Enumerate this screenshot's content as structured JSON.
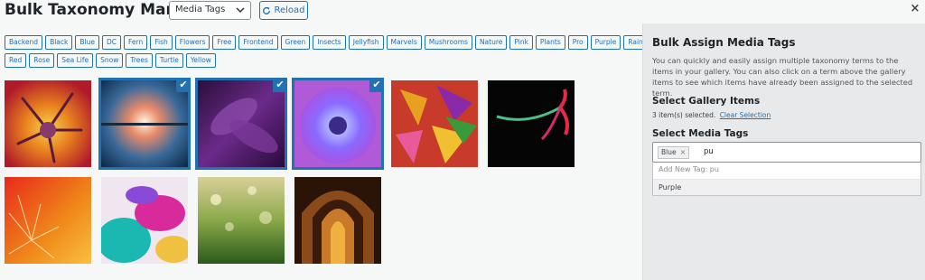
{
  "app": {
    "title": "Bulk Taxonomy Manager",
    "taxonomy_select": "Media Tags",
    "reload_label": "Reload",
    "close_label": "×"
  },
  "terms_row1": [
    "Backend",
    "Black",
    "Blue",
    "DC",
    "Fern",
    "Fish",
    "Flowers",
    "Free",
    "Frontend",
    "Green",
    "Insects",
    "Jellyfish",
    "Marvels",
    "Mushrooms",
    "Nature",
    "Pink",
    "Plants",
    "Pro",
    "Purple",
    "Rainbow"
  ],
  "terms_row2": [
    "Red",
    "Rose",
    "Sea Life",
    "Snow",
    "Trees",
    "Turtle",
    "Yellow"
  ],
  "gallery": {
    "items": [
      {
        "name": "flower-macro",
        "selected": false
      },
      {
        "name": "sunset-reflection",
        "selected": true
      },
      {
        "name": "purple-leaves",
        "selected": true
      },
      {
        "name": "chrysanthemum",
        "selected": true
      },
      {
        "name": "autumn-leaves",
        "selected": false
      },
      {
        "name": "red-flower-black",
        "selected": false
      },
      {
        "name": "dandelion",
        "selected": false
      },
      {
        "name": "ink-colors",
        "selected": false
      },
      {
        "name": "grass-bokeh",
        "selected": false
      },
      {
        "name": "arches",
        "selected": false
      }
    ],
    "check_glyph": "✔"
  },
  "sidebar": {
    "title": "Bulk Assign Media Tags",
    "description": "You can quickly and easily assign multiple taxonomy terms to the items in your gallery. You can also click on a term above the gallery items to see which items have already been assigned to the selected term.",
    "select_items_heading": "Select Gallery Items",
    "selected_count": "3 item(s) selected.",
    "clear_selection": "Clear Selection",
    "select_tags_heading": "Select Media Tags",
    "chip_label": "Blue",
    "chip_remove": "×",
    "input_value": "pu",
    "add_new": "Add New Tag: pu",
    "suggestion": "Purple"
  },
  "colors": {
    "accent": "#2271b1",
    "sidebar_bg": "#e8e9ea",
    "page_bg": "#f6f7f7"
  }
}
